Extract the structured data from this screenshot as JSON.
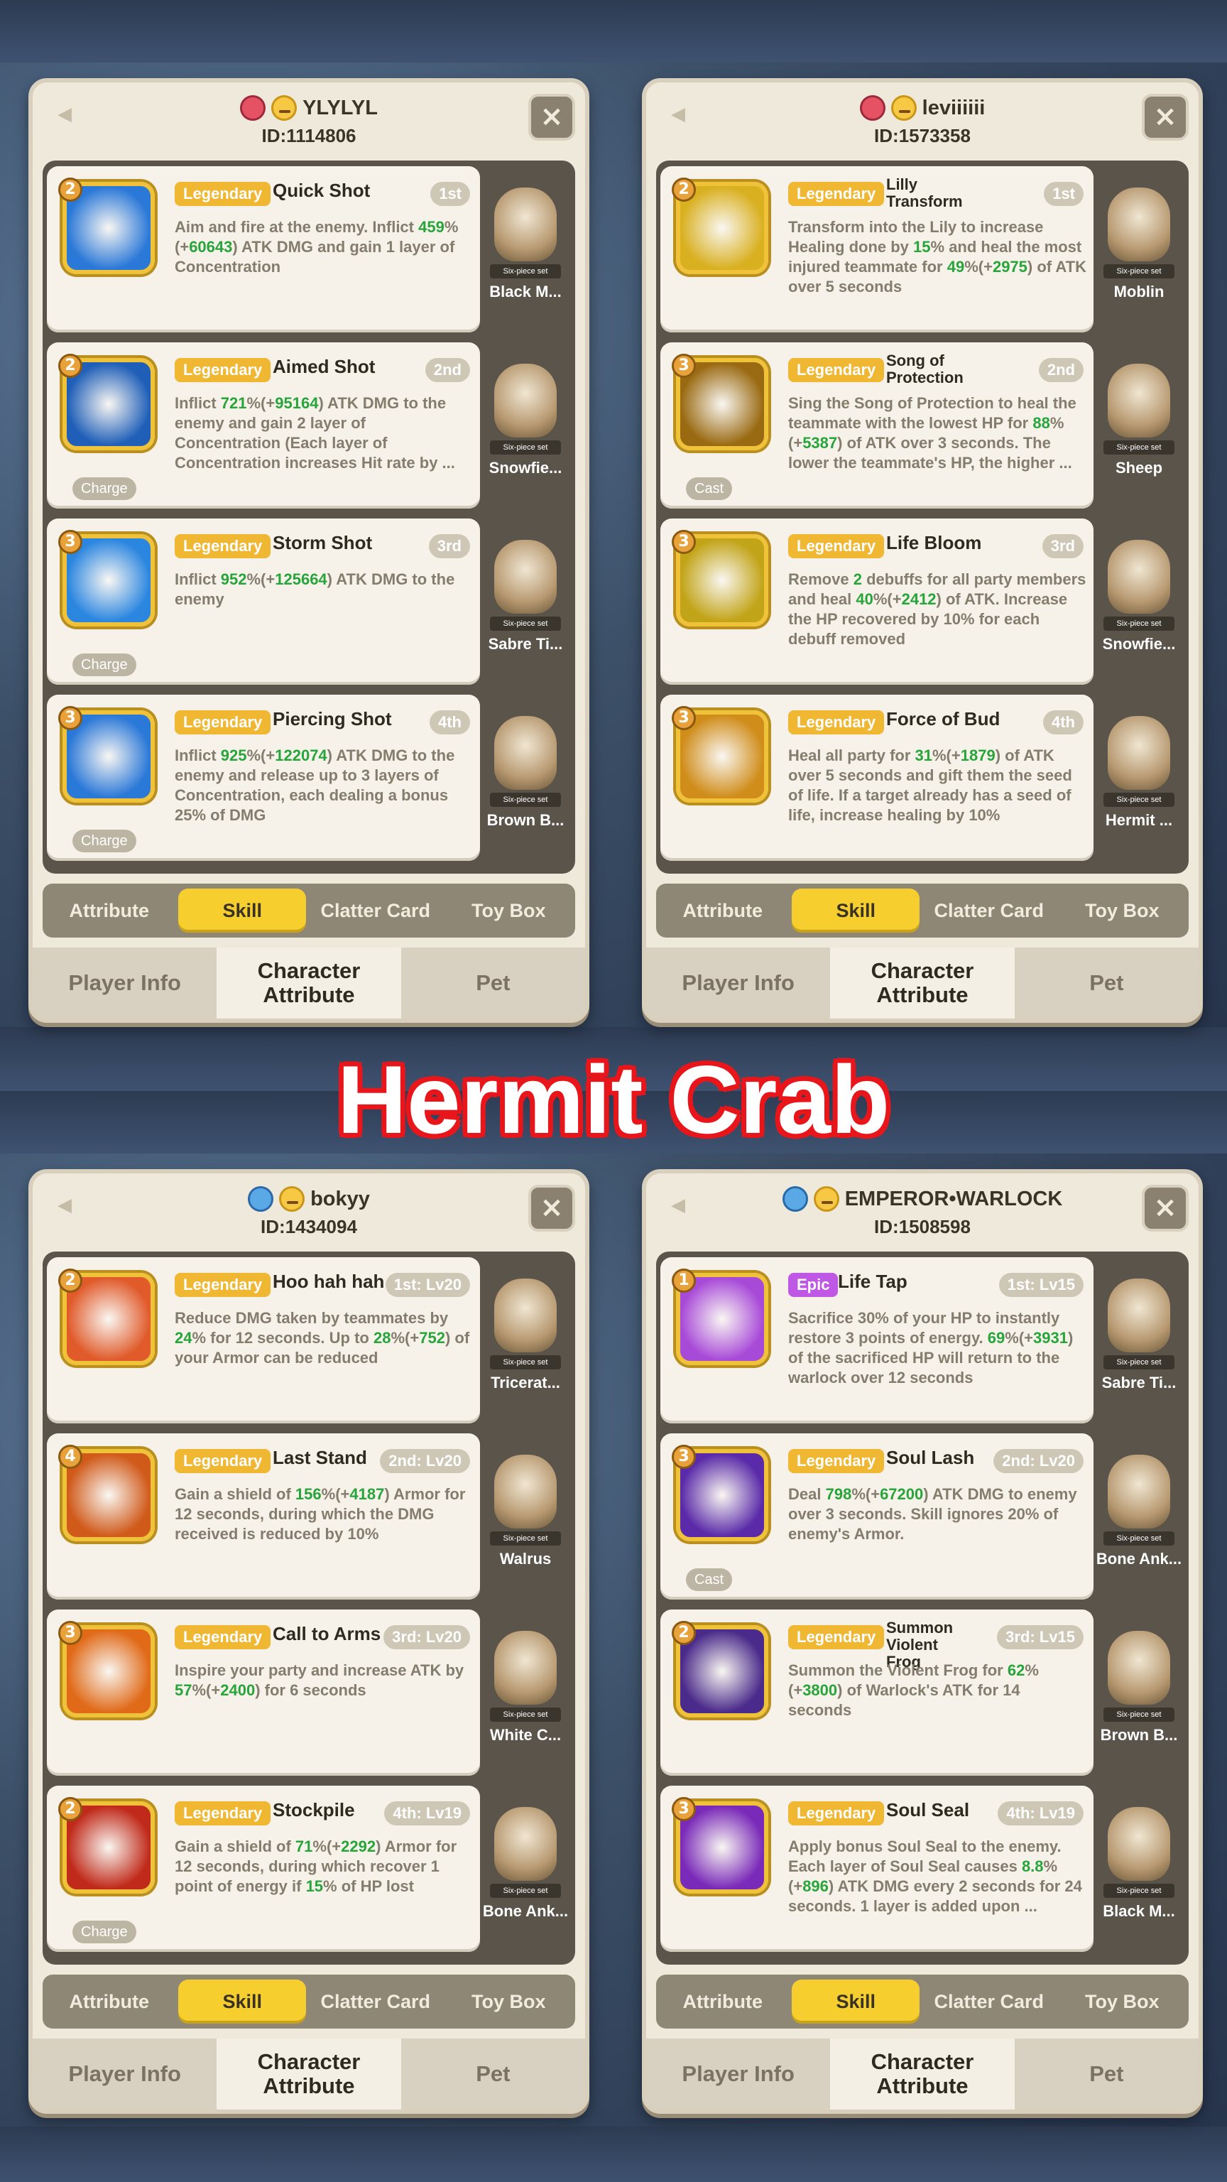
{
  "banner": "Hermit Crab",
  "common": {
    "tabs": [
      "Attribute",
      "Skill",
      "Clatter Card",
      "Toy Box"
    ],
    "footer": [
      "Player Info",
      "Character\nAttribute",
      "Pet"
    ],
    "set_label": "Six-piece set",
    "close": "×"
  },
  "panels": [
    {
      "name": "YLYLYL",
      "id": "ID:1114806",
      "key": "red",
      "skills": [
        {
          "lvl": "2",
          "rarity": "Legendary",
          "name": "Quick Shot",
          "rank": "1st",
          "desc": [
            [
              "Aim and fire at the enemy. Inflict ",
              0
            ],
            [
              "459",
              1
            ],
            [
              "%(+",
              0
            ],
            [
              "60643",
              1
            ],
            [
              ") ATK DMG and gain 1 layer of Concentration",
              0
            ]
          ],
          "tag": "",
          "pet": "Black M...",
          "icon": "#2a78d8"
        },
        {
          "lvl": "2",
          "rarity": "Legendary",
          "name": "Aimed Shot",
          "rank": "2nd",
          "desc": [
            [
              "Inflict ",
              0
            ],
            [
              "721",
              1
            ],
            [
              "%(+",
              0
            ],
            [
              "95164",
              1
            ],
            [
              ") ATK DMG to the enemy and gain 2 layer of Concentration (Each layer of Concentration increases Hit rate by ...",
              0
            ]
          ],
          "tag": "Charge",
          "pet": "Snowfie...",
          "icon": "#1f5fb8"
        },
        {
          "lvl": "3",
          "rarity": "Legendary",
          "name": "Storm Shot",
          "rank": "3rd",
          "desc": [
            [
              "Inflict ",
              0
            ],
            [
              "952",
              1
            ],
            [
              "%(+",
              0
            ],
            [
              "125664",
              1
            ],
            [
              ") ATK DMG to the enemy",
              0
            ]
          ],
          "tag": "Charge",
          "pet": "Sabre Ti...",
          "icon": "#2b86e0"
        },
        {
          "lvl": "3",
          "rarity": "Legendary",
          "name": "Piercing Shot",
          "rank": "4th",
          "desc": [
            [
              "Inflict ",
              0
            ],
            [
              "925",
              1
            ],
            [
              "%(+",
              0
            ],
            [
              "122074",
              1
            ],
            [
              ") ATK DMG to the enemy and release up to 3 layers of Concentration, each dealing a bonus 25% of DMG",
              0
            ]
          ],
          "tag": "Charge",
          "pet": "Brown B...",
          "icon": "#2a78d8"
        }
      ]
    },
    {
      "name": "leviiiiii",
      "id": "ID:1573358",
      "key": "red",
      "skills": [
        {
          "lvl": "2",
          "rarity": "Legendary",
          "name": "Lilly Transform",
          "rank": "1st",
          "desc": [
            [
              "Transform into the Lily to increase Healing done by ",
              0
            ],
            [
              "15",
              1
            ],
            [
              "% and heal the most injured teammate for ",
              0
            ],
            [
              "49",
              1
            ],
            [
              "%(+",
              0
            ],
            [
              "2975",
              1
            ],
            [
              ") of ATK over 5 seconds",
              0
            ]
          ],
          "tag": "",
          "pet": "Moblin",
          "icon": "#d9b020"
        },
        {
          "lvl": "3",
          "rarity": "Legendary",
          "name": "Song of Protection",
          "rank": "2nd",
          "desc": [
            [
              "Sing the Song of Protection to heal the teammate with the lowest HP for ",
              0
            ],
            [
              "88",
              1
            ],
            [
              "%(+",
              0
            ],
            [
              "5387",
              1
            ],
            [
              ") of ATK over 3 seconds. The lower the teammate's HP, the higher ...",
              0
            ]
          ],
          "tag": "Cast",
          "pet": "Sheep",
          "icon": "#9a6a12"
        },
        {
          "lvl": "3",
          "rarity": "Legendary",
          "name": "Life Bloom",
          "rank": "3rd",
          "desc": [
            [
              "Remove ",
              0
            ],
            [
              "2",
              1
            ],
            [
              " debuffs for all party members and heal ",
              0
            ],
            [
              "40",
              1
            ],
            [
              "%(+",
              0
            ],
            [
              "2412",
              1
            ],
            [
              ") of ATK. Increase the HP recovered by 10% for each debuff removed",
              0
            ]
          ],
          "tag": "",
          "pet": "Snowfie...",
          "icon": "#c2a418"
        },
        {
          "lvl": "3",
          "rarity": "Legendary",
          "name": "Force of Bud",
          "rank": "4th",
          "desc": [
            [
              "Heal all party for ",
              0
            ],
            [
              "31",
              1
            ],
            [
              "%(+",
              0
            ],
            [
              "1879",
              1
            ],
            [
              ") of ATK over 5 seconds and gift them the seed of life. If a target already has a seed of life, increase healing by 10%",
              0
            ]
          ],
          "tag": "",
          "pet": "Hermit ...",
          "icon": "#d08d1a"
        }
      ]
    },
    {
      "name": "bokyy",
      "id": "ID:1434094",
      "key": "blue",
      "skills": [
        {
          "lvl": "2",
          "rarity": "Legendary",
          "name": "Hoo hah hah",
          "rank": "1st: Lv20",
          "desc": [
            [
              "Reduce DMG taken by teammates by ",
              0
            ],
            [
              "24",
              1
            ],
            [
              "% for 12 seconds. Up to ",
              0
            ],
            [
              "28",
              1
            ],
            [
              "%(+",
              0
            ],
            [
              "752",
              1
            ],
            [
              ") of your Armor can be reduced",
              0
            ]
          ],
          "tag": "",
          "pet": "Tricerat...",
          "icon": "#e05a2a"
        },
        {
          "lvl": "4",
          "rarity": "Legendary",
          "name": "Last Stand",
          "rank": "2nd: Lv20",
          "desc": [
            [
              "Gain a shield of ",
              0
            ],
            [
              "156",
              1
            ],
            [
              "%(+",
              0
            ],
            [
              "4187",
              1
            ],
            [
              ") Armor for 12 seconds, during which the DMG received is reduced by 10%",
              0
            ]
          ],
          "tag": "",
          "pet": "Walrus",
          "icon": "#d05a1a"
        },
        {
          "lvl": "3",
          "rarity": "Legendary",
          "name": "Call to Arms",
          "rank": "3rd: Lv20",
          "desc": [
            [
              "Inspire your party and increase ATK by ",
              0
            ],
            [
              "57",
              1
            ],
            [
              "%(+",
              0
            ],
            [
              "2400",
              1
            ],
            [
              ") for 6 seconds",
              0
            ]
          ],
          "tag": "",
          "pet": "White C...",
          "icon": "#e06a18"
        },
        {
          "lvl": "2",
          "rarity": "Legendary",
          "name": "Stockpile",
          "rank": "4th: Lv19",
          "desc": [
            [
              "Gain a shield of ",
              0
            ],
            [
              "71",
              1
            ],
            [
              "%(+",
              0
            ],
            [
              "2292",
              1
            ],
            [
              ") Armor for 12 seconds, during which recover 1 point of energy if ",
              0
            ],
            [
              "15",
              1
            ],
            [
              "% of HP lost",
              0
            ]
          ],
          "tag": "Charge",
          "pet": "Bone Ank...",
          "icon": "#c02a1a"
        }
      ]
    },
    {
      "name": "EMPEROR•WARLOCK",
      "id": "ID:1508598",
      "key": "blue",
      "skills": [
        {
          "lvl": "1",
          "rarity": "Epic",
          "name": "Life Tap",
          "rank": "1st: Lv15",
          "desc": [
            [
              "Sacrifice 30% of your HP to instantly restore 3 points of energy. ",
              0
            ],
            [
              "69",
              1
            ],
            [
              "%(+",
              0
            ],
            [
              "3931",
              1
            ],
            [
              ") of the sacrificed HP will return to the warlock over 12 seconds",
              0
            ]
          ],
          "tag": "",
          "pet": "Sabre Ti...",
          "icon": "#a84ad8"
        },
        {
          "lvl": "3",
          "rarity": "Legendary",
          "name": "Soul Lash",
          "rank": "2nd: Lv20",
          "desc": [
            [
              "Deal ",
              0
            ],
            [
              "798",
              1
            ],
            [
              "%(+",
              0
            ],
            [
              "67200",
              1
            ],
            [
              ") ATK DMG to enemy over 3 seconds. Skill ignores 20% of enemy's Armor.",
              0
            ]
          ],
          "tag": "Cast",
          "pet": "Bone Ank...",
          "icon": "#5a2aa8"
        },
        {
          "lvl": "2",
          "rarity": "Legendary",
          "name": "Summon Violent Frog",
          "rank": "3rd: Lv15",
          "desc": [
            [
              "Summon the Violent Frog for ",
              0
            ],
            [
              "62",
              1
            ],
            [
              "%(+",
              0
            ],
            [
              "3800",
              1
            ],
            [
              ") of Warlock's ATK for 14 seconds",
              0
            ]
          ],
          "tag": "",
          "pet": "Brown B...",
          "icon": "#4a2a8a"
        },
        {
          "lvl": "3",
          "rarity": "Legendary",
          "name": "Soul Seal",
          "rank": "4th: Lv19",
          "desc": [
            [
              "Apply bonus Soul Seal to the enemy. Each layer of Soul Seal causes ",
              0
            ],
            [
              "8.8",
              1
            ],
            [
              "%(+",
              0
            ],
            [
              "896",
              1
            ],
            [
              ") ATK DMG every 2 seconds for 24 seconds. 1 layer is added upon ...",
              0
            ]
          ],
          "tag": "",
          "pet": "Black M...",
          "icon": "#7a2ab8"
        }
      ]
    }
  ]
}
